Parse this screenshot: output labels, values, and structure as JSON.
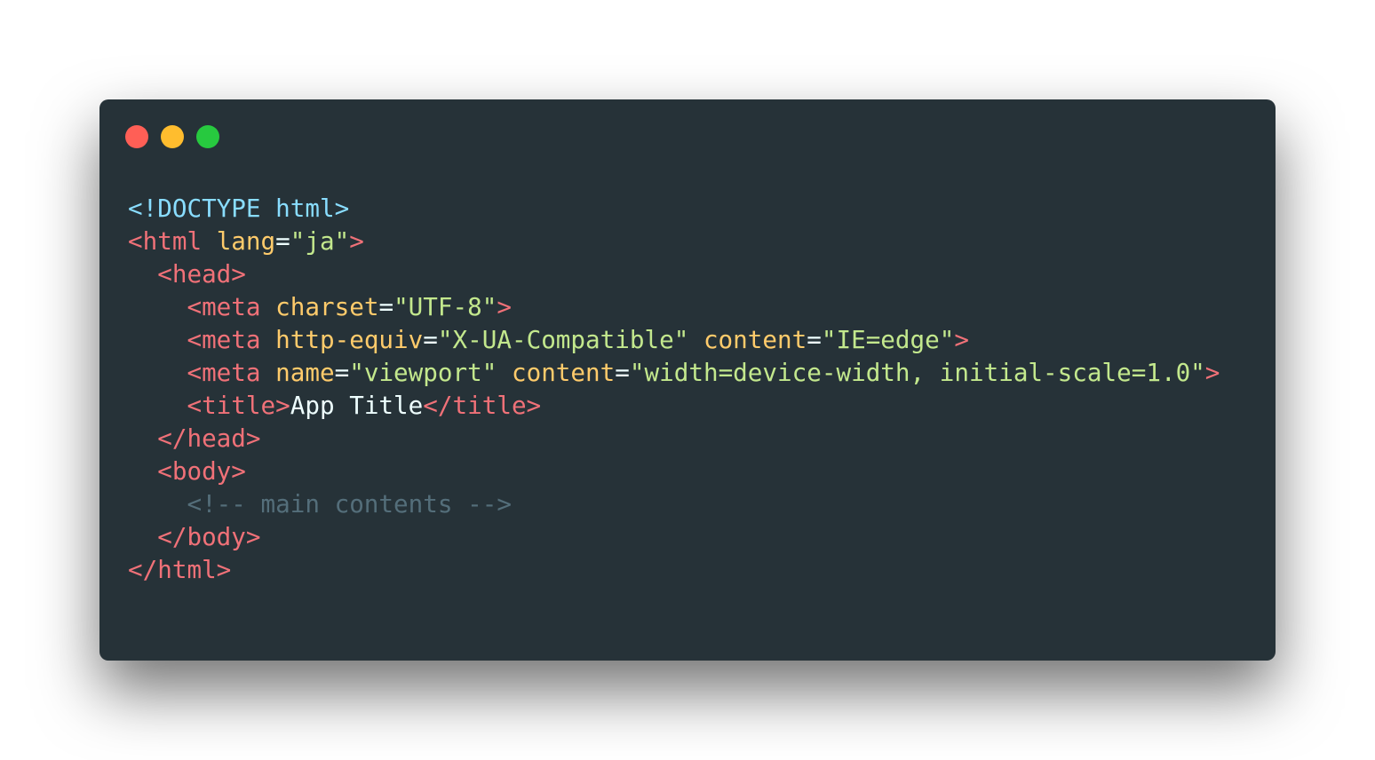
{
  "window": {
    "controls": [
      {
        "name": "close",
        "color": "#ff5f56"
      },
      {
        "name": "minimize",
        "color": "#ffbd2e"
      },
      {
        "name": "zoom",
        "color": "#27c93f"
      }
    ]
  },
  "theme": {
    "background": "#263238",
    "tag": "#f07178",
    "attribute": "#ffcb6b",
    "string": "#c3e88d",
    "punctuation": "#eeffff",
    "comment": "#546e7a",
    "doctype": "#89ddff"
  },
  "code": {
    "lines": [
      [
        {
          "t": "doctype",
          "v": "<!DOCTYPE html>"
        }
      ],
      [
        {
          "t": "tag",
          "v": "<html "
        },
        {
          "t": "attr",
          "v": "lang"
        },
        {
          "t": "punc",
          "v": "="
        },
        {
          "t": "str",
          "v": "\"ja\""
        },
        {
          "t": "tag",
          "v": ">"
        }
      ],
      [
        {
          "t": "tag",
          "v": "  <head>"
        }
      ],
      [
        {
          "t": "tag",
          "v": "    <meta "
        },
        {
          "t": "attr",
          "v": "charset"
        },
        {
          "t": "punc",
          "v": "="
        },
        {
          "t": "str",
          "v": "\"UTF-8\""
        },
        {
          "t": "tag",
          "v": ">"
        }
      ],
      [
        {
          "t": "tag",
          "v": "    <meta "
        },
        {
          "t": "attr",
          "v": "http-equiv"
        },
        {
          "t": "punc",
          "v": "="
        },
        {
          "t": "str",
          "v": "\"X-UA-Compatible\" "
        },
        {
          "t": "attr",
          "v": "content"
        },
        {
          "t": "punc",
          "v": "="
        },
        {
          "t": "str",
          "v": "\"IE=edge\""
        },
        {
          "t": "tag",
          "v": ">"
        }
      ],
      [
        {
          "t": "tag",
          "v": "    <meta "
        },
        {
          "t": "attr",
          "v": "name"
        },
        {
          "t": "punc",
          "v": "="
        },
        {
          "t": "str",
          "v": "\"viewport\" "
        },
        {
          "t": "attr",
          "v": "content"
        },
        {
          "t": "punc",
          "v": "="
        },
        {
          "t": "str",
          "v": "\"width=device-width, initial-scale=1.0\""
        },
        {
          "t": "tag",
          "v": ">"
        }
      ],
      [
        {
          "t": "tag",
          "v": "    <title>"
        },
        {
          "t": "text",
          "v": "App Title"
        },
        {
          "t": "tag",
          "v": "</title>"
        }
      ],
      [
        {
          "t": "tag",
          "v": "  </head>"
        }
      ],
      [
        {
          "t": "tag",
          "v": "  <body>"
        }
      ],
      [
        {
          "t": "comment",
          "v": "    <!-- main contents -->"
        }
      ],
      [
        {
          "t": "tag",
          "v": "  </body>"
        }
      ],
      [
        {
          "t": "tag",
          "v": "</html>"
        }
      ]
    ]
  }
}
